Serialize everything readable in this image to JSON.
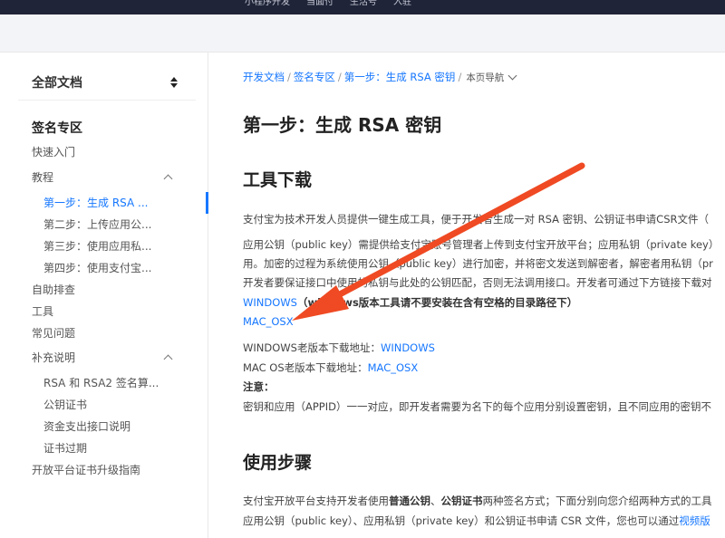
{
  "topnav": [
    "小程序开发",
    "当面付",
    "生活号",
    "入驻"
  ],
  "sidebar": {
    "header": "全部文档",
    "section": "签名专区",
    "items": [
      {
        "label": "快速入门"
      },
      {
        "label": "教程",
        "expanded": true
      },
      {
        "label": "第一步：生成 RSA ...",
        "active": true
      },
      {
        "label": "第二步：上传应用公..."
      },
      {
        "label": "第三步：使用应用私..."
      },
      {
        "label": "第四步：使用支付宝..."
      },
      {
        "label": "自助排查"
      },
      {
        "label": "工具"
      },
      {
        "label": "常见问题"
      },
      {
        "label": "补充说明",
        "expanded": true
      },
      {
        "label": "RSA 和 RSA2 签名算..."
      },
      {
        "label": "公钥证书"
      },
      {
        "label": "资金支出接口说明"
      },
      {
        "label": "证书过期"
      },
      {
        "label": "开放平台证书升级指南"
      }
    ]
  },
  "breadcrumb": {
    "items": [
      "开发文档",
      "签名专区",
      "第一步：生成 RSA 密钥"
    ],
    "sep": "/",
    "nav": "本页导航"
  },
  "content": {
    "title": "第一步：生成 RSA 密钥",
    "section1": "工具下载",
    "p1": "支付宝为技术开发人员提供一键生成工具，便于开发者生成一对 RSA 密钥、公钥证书申请CSR文件（",
    "p2a": "应用公钥（public key）需提供给支付宝账号管理者上传到支付宝开放平台；应用私钥（private key）",
    "p2b": "用。加密的过程为系统使用公钥（public key）进行加密，并将密文发送到解密者，解密者用私钥（pr",
    "p2c": "开发者要保证接口中使用的私钥与此处的公钥匹配，否则无法调用接口。开发者可通过下方链接下载对",
    "win_link": "WINDOWS",
    "win_note": "（windows版本工具请不要安装在含有空格的目录路径下）",
    "mac_link": "MAC_OSX",
    "old_win_label": "WINDOWS老版本下载地址：",
    "old_win_link": "WINDOWS",
    "old_mac_label": "MAC OS老版本下载地址：",
    "old_mac_link": "MAC_OSX",
    "note_label": "注意：",
    "note_text": "密钥和应用（APPID）一一对应，即开发者需要为名下的每个应用分别设置密钥，且不同应用的密钥不",
    "section2": "使用步骤",
    "p3_pre": "支付宝开放平台支持开发者使用",
    "p3_b1": "普通公钥",
    "p3_mid": "、",
    "p3_b2": "公钥证书",
    "p3_post": "两种签名方式；下面分别向您介绍两种方式的工具",
    "p4_pre": "应用公钥（public key）、应用私钥（private key）和公钥证书申请 CSR 文件，您也可以通过",
    "p4_link": "视频版"
  },
  "annotation": {
    "color": "#ef4a23"
  }
}
